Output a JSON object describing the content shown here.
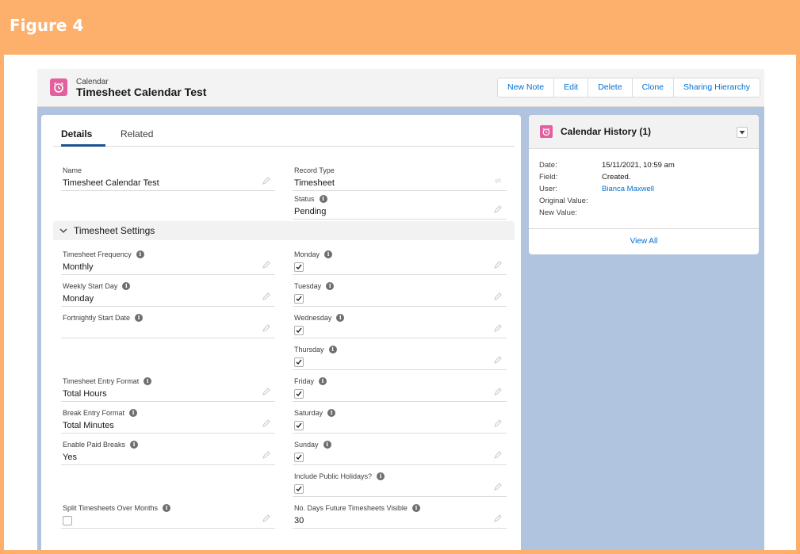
{
  "figure_title": "Figure 4",
  "header": {
    "object_type": "Calendar",
    "record_title": "Timesheet Calendar Test",
    "buttons": [
      "New Note",
      "Edit",
      "Delete",
      "Clone",
      "Sharing Hierarchy"
    ]
  },
  "tabs": [
    "Details",
    "Related"
  ],
  "details": {
    "name_label": "Name",
    "name_value": "Timesheet Calendar Test",
    "record_type_label": "Record Type",
    "record_type_value": "Timesheet",
    "status_label": "Status",
    "status_value": "Pending"
  },
  "section": {
    "title": "Timesheet Settings",
    "left_fields": [
      {
        "label": "Timesheet Frequency",
        "value": "Monthly"
      },
      {
        "label": "Weekly Start Day",
        "value": "Monday"
      },
      {
        "label": "Fortnightly Start Date",
        "value": ""
      },
      {
        "label": "Timesheet Entry Format",
        "value": "Total Hours"
      },
      {
        "label": "Break Entry Format",
        "value": "Total Minutes"
      },
      {
        "label": "Enable Paid Breaks",
        "value": "Yes"
      },
      {
        "label": "Split Timesheets Over Months",
        "value": ""
      }
    ],
    "right_fields": [
      {
        "label": "Monday",
        "checked": true
      },
      {
        "label": "Tuesday",
        "checked": true
      },
      {
        "label": "Wednesday",
        "checked": true
      },
      {
        "label": "Thursday",
        "checked": true
      },
      {
        "label": "Friday",
        "checked": true
      },
      {
        "label": "Saturday",
        "checked": true
      },
      {
        "label": "Sunday",
        "checked": true
      },
      {
        "label": "Include Public Holidays?",
        "checked": true
      },
      {
        "label": "No. Days Future Timesheets Visible",
        "value": "30"
      }
    ]
  },
  "history": {
    "title": "Calendar History (1)",
    "rows": [
      {
        "label": "Date:",
        "value": "15/11/2021, 10:59 am"
      },
      {
        "label": "Field:",
        "value": "Created."
      },
      {
        "label": "User:",
        "value": "Bianca Maxwell"
      },
      {
        "label": "Original Value:",
        "value": ""
      },
      {
        "label": "New Value:",
        "value": ""
      }
    ],
    "view_all": "View All"
  },
  "colors": {
    "figure_bg": "#fdb06c",
    "brand_icon": "#e3609f",
    "link": "#0070d2",
    "tab_underline": "#1b5297",
    "page_bg": "#b0c4df"
  }
}
